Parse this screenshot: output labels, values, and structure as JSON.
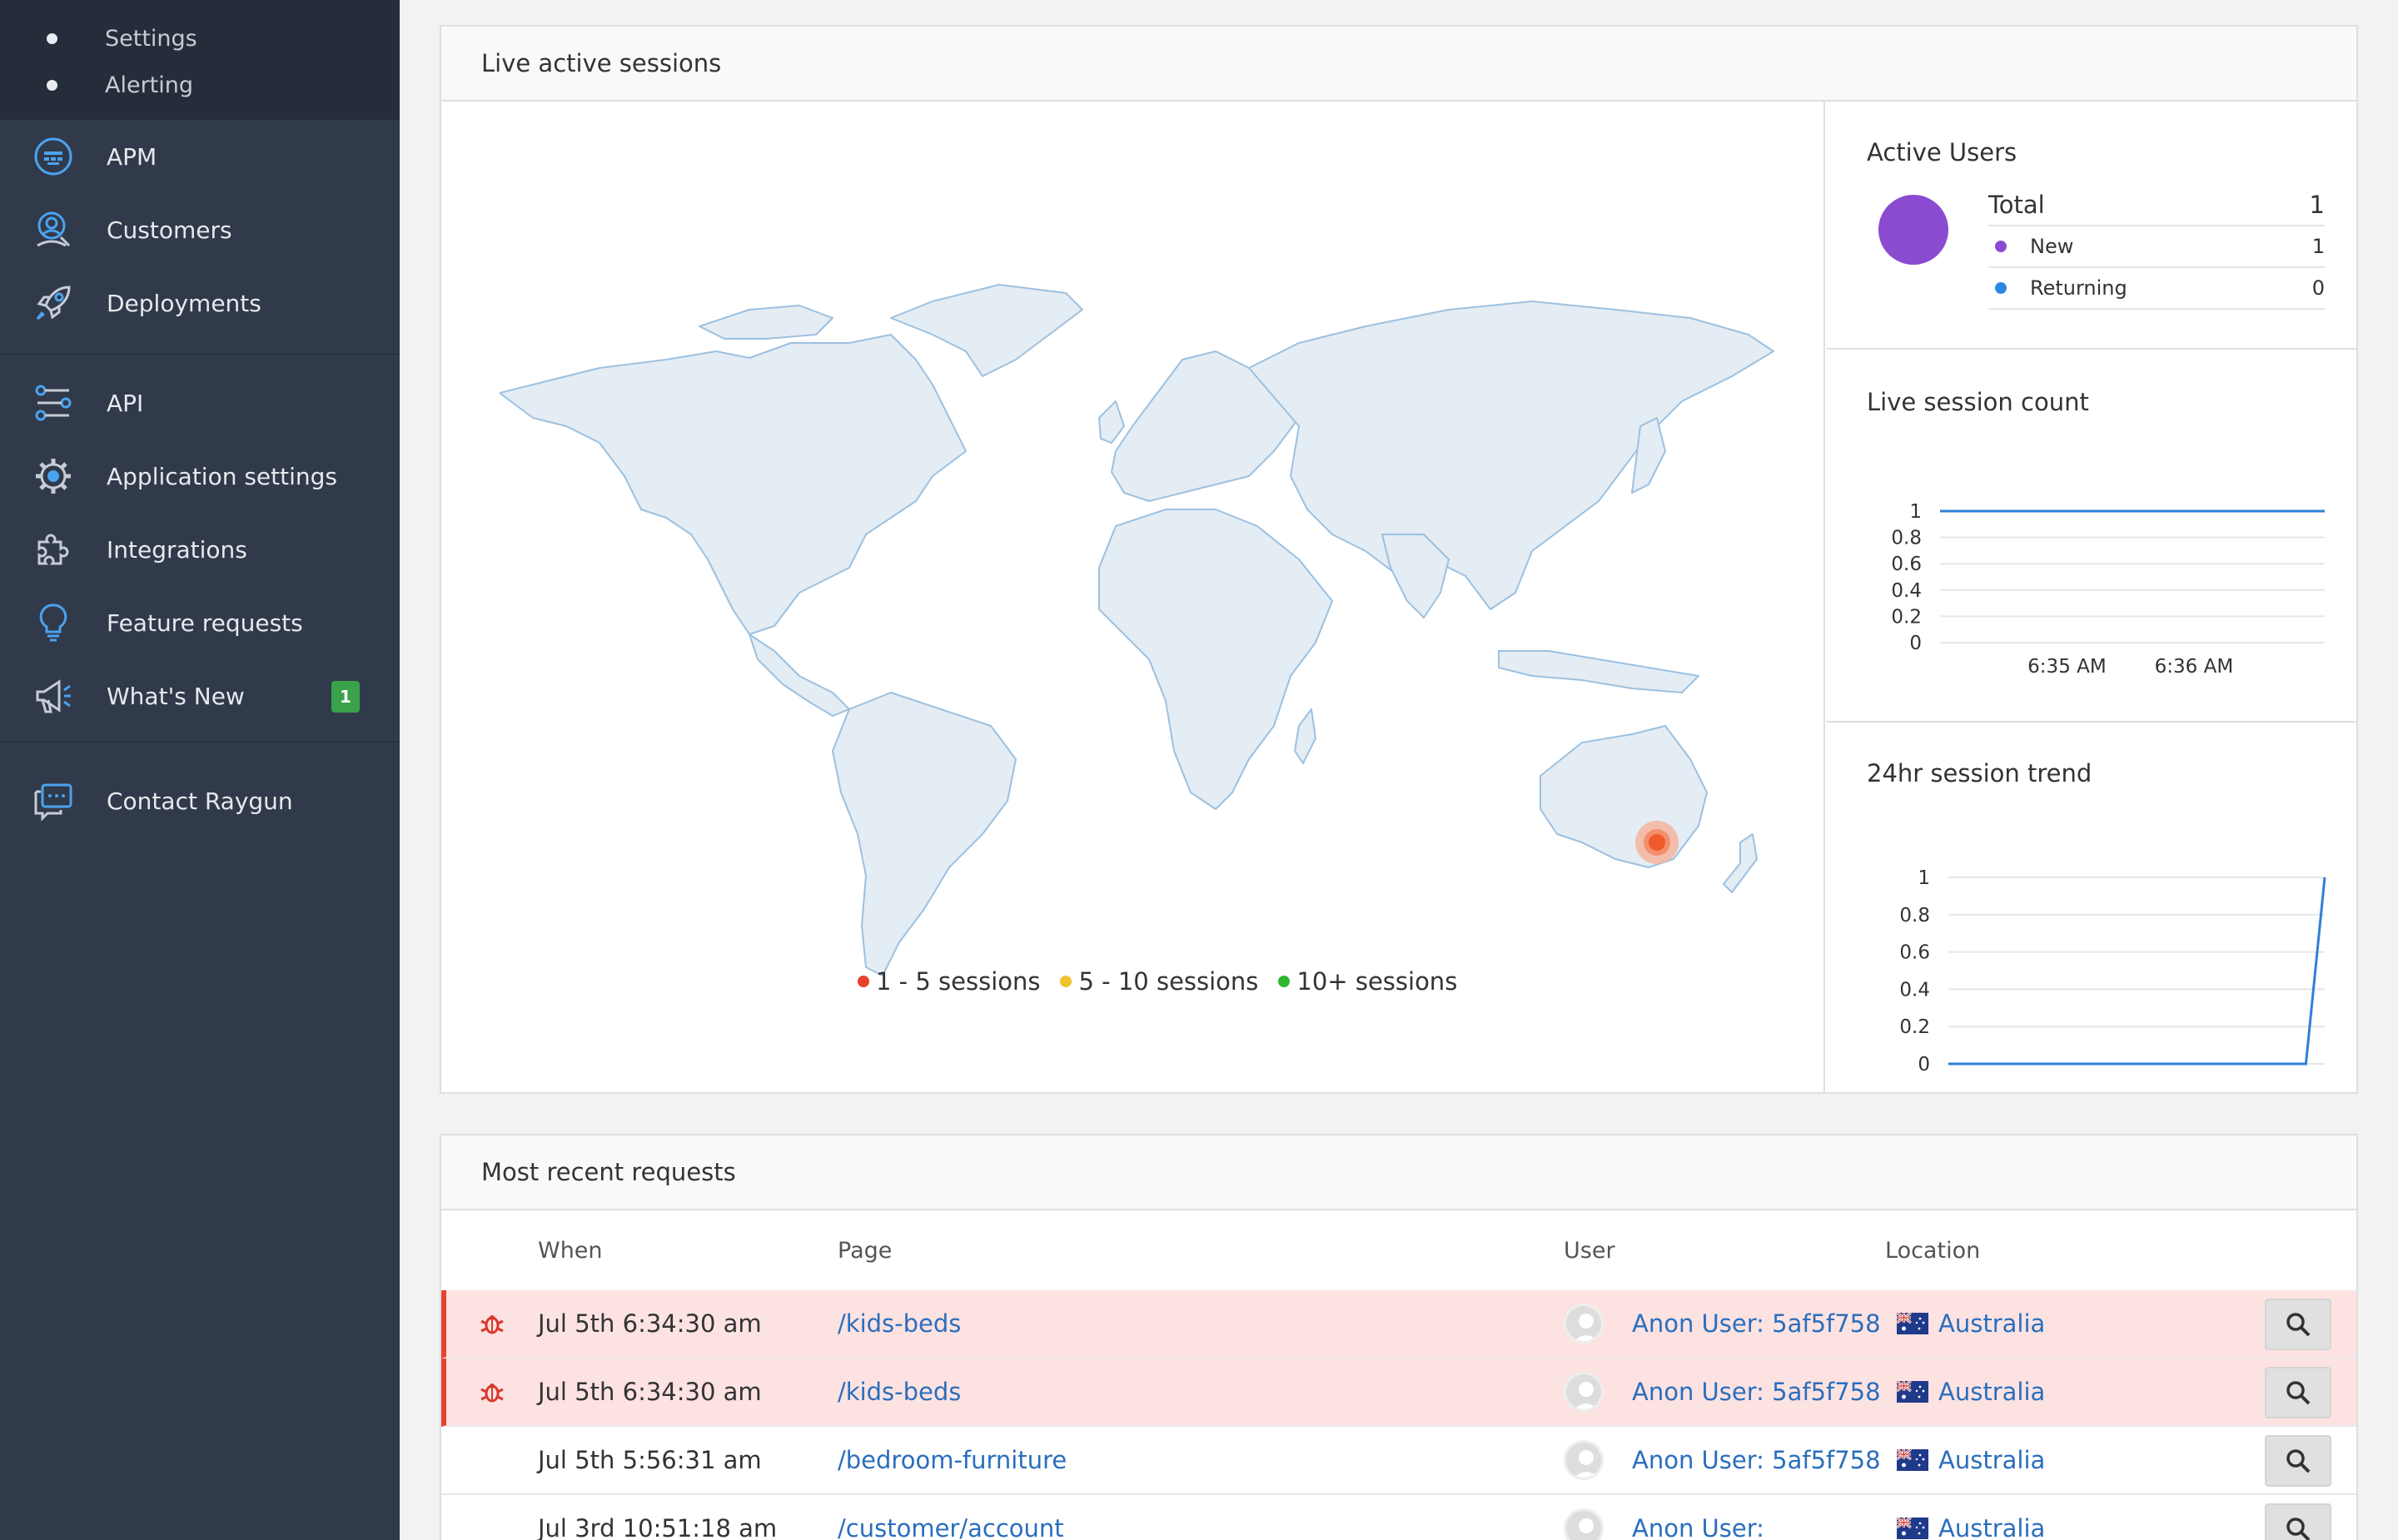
{
  "sidebar": {
    "subnav": [
      {
        "label": "Settings"
      },
      {
        "label": "Alerting"
      }
    ],
    "group1": [
      {
        "label": "APM",
        "icon": "apm-icon"
      },
      {
        "label": "Customers",
        "icon": "customers-icon"
      },
      {
        "label": "Deployments",
        "icon": "rocket-icon"
      }
    ],
    "group2": [
      {
        "label": "API",
        "icon": "api-icon"
      },
      {
        "label": "Application settings",
        "icon": "gear-icon"
      },
      {
        "label": "Integrations",
        "icon": "puzzle-icon"
      },
      {
        "label": "Feature requests",
        "icon": "lightbulb-icon"
      },
      {
        "label": "What's New",
        "icon": "megaphone-icon",
        "badge": "1"
      }
    ],
    "group3": [
      {
        "label": "Contact Raygun",
        "icon": "chat-icon"
      }
    ]
  },
  "sessions_panel": {
    "title": "Live active sessions",
    "legend": [
      {
        "label": "1 - 5 sessions",
        "color": "#e8412c"
      },
      {
        "label": "5 - 10 sessions",
        "color": "#f2c12e"
      },
      {
        "label": "10+ sessions",
        "color": "#2eb82e"
      }
    ],
    "active_users": {
      "title": "Active Users",
      "total_label": "Total",
      "total_value": "1",
      "rows": [
        {
          "label": "New",
          "value": "1",
          "color": "#8a4bd1"
        },
        {
          "label": "Returning",
          "value": "0",
          "color": "#2e86de"
        }
      ]
    },
    "live_count_title": "Live session count",
    "trend_title": "24hr session trend"
  },
  "chart_data": [
    {
      "type": "line",
      "title": "Live session count",
      "x": [
        "6:35 AM",
        "6:36 AM"
      ],
      "series": [
        {
          "values": [
            1,
            1,
            1
          ]
        }
      ],
      "ylim": [
        0,
        1
      ],
      "yticks": [
        "0",
        "0.2",
        "0.4",
        "0.6",
        "0.8",
        "1"
      ],
      "color": "#2e7fd9"
    },
    {
      "type": "line",
      "title": "24hr session trend",
      "series": [
        {
          "values": [
            0,
            0,
            0,
            1
          ]
        }
      ],
      "ylim": [
        0,
        1
      ],
      "yticks": [
        "0",
        "0.2",
        "0.4",
        "0.6",
        "0.8",
        "1"
      ],
      "color": "#2e7fd9"
    }
  ],
  "requests_panel": {
    "title": "Most recent requests",
    "columns": {
      "when": "When",
      "page": "Page",
      "user": "User",
      "location": "Location"
    },
    "rows": [
      {
        "when": "Jul 5th 6:34:30 am",
        "page": "/kids-beds",
        "user": "Anon User: 5af5f758",
        "location": "Australia",
        "error": true
      },
      {
        "when": "Jul 5th 6:34:30 am",
        "page": "/kids-beds",
        "user": "Anon User: 5af5f758",
        "location": "Australia",
        "error": true
      },
      {
        "when": "Jul 5th 5:56:31 am",
        "page": "/bedroom-furniture",
        "user": "Anon User: 5af5f758",
        "location": "Australia",
        "error": false
      },
      {
        "when": "Jul 3rd 10:51:18 am",
        "page": "/customer/account",
        "user": "Anon User:",
        "location": "Australia",
        "error": false
      }
    ]
  }
}
